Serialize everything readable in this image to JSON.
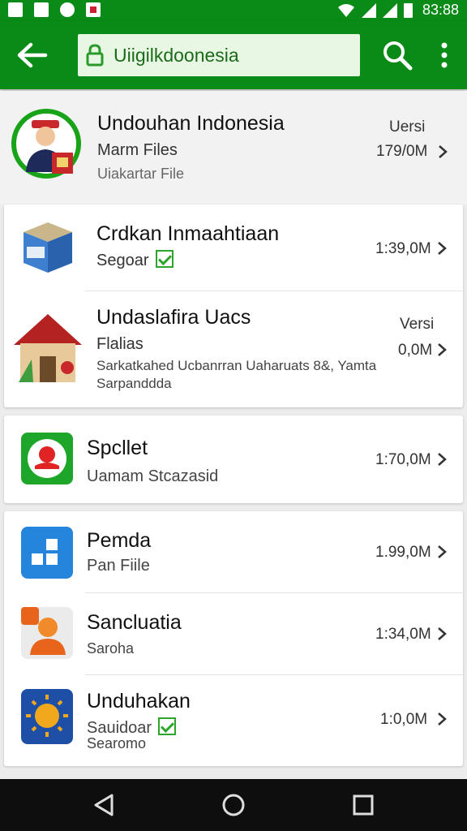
{
  "status_bar": {
    "time": "83:88",
    "icons": [
      "notification-icon",
      "sim-icon",
      "sync-icon",
      "image-icon",
      "wifi-icon",
      "signal-icon",
      "battery-icon"
    ]
  },
  "app_bar": {
    "url_text": "Uiigilkdoonesia",
    "icons": [
      "back-arrow-icon",
      "lock-icon",
      "search-icon",
      "more-vert-icon"
    ],
    "color": "#0a8a16"
  },
  "header_item": {
    "title": "Undouhan Indonesia",
    "subtitle": "Marm Files",
    "detail": "Uiakartar File",
    "version_label": "Uersi",
    "size": "179/0M"
  },
  "items": [
    {
      "title": "Crdkan Inmaahtiaan",
      "subtitle": "Segoar",
      "checked": true,
      "size": "1:39,0M",
      "icon": "package-box-icon"
    },
    {
      "title": "Undaslafira Uacs",
      "subtitle": "Flalias",
      "detail": "Sarkatkahed Ucbanrran Uaharuats 8&, Yamta",
      "detail2": "Sarpanddda",
      "version_label": "Versi",
      "size": "0,0M",
      "icon": "house-icon"
    },
    {
      "title": "Spcllet",
      "subtitle": "Uamam Stcazasid",
      "size": "1:70,0M",
      "icon": "red-avatar-icon"
    },
    {
      "title": "Pemda",
      "subtitle": "Pan Fiile",
      "size": "1.99,0M",
      "icon": "blue-grid-icon"
    },
    {
      "title": "Sancluatia",
      "subtitle": "Saroha",
      "size": "1:34,0M",
      "icon": "orange-person-icon"
    },
    {
      "title": "Unduhakan",
      "subtitle": "Sauidoar",
      "detail": "Searomo",
      "checked": true,
      "size": "1:0,0M",
      "icon": "sun-icon"
    }
  ],
  "nav_bar": {
    "icons": [
      "nav-back-icon",
      "nav-home-icon",
      "nav-recents-icon"
    ]
  }
}
